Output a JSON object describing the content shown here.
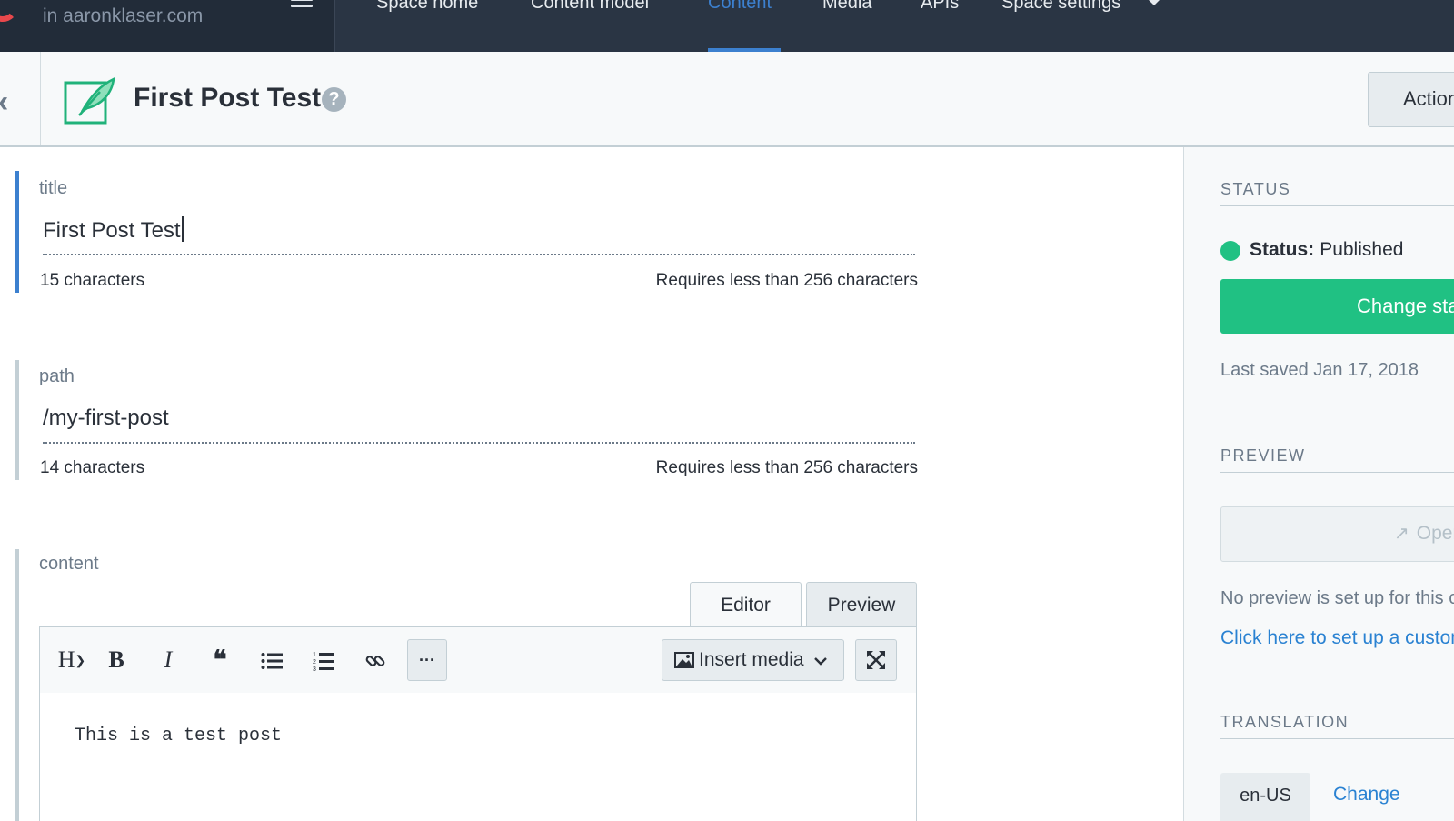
{
  "topbar": {
    "space_label": "in aaronklaser.com",
    "nav": [
      {
        "label": "Space home",
        "active": false
      },
      {
        "label": "Content model",
        "active": false
      },
      {
        "label": "Content",
        "active": true
      },
      {
        "label": "Media",
        "active": false
      },
      {
        "label": "APIs",
        "active": false
      },
      {
        "label": "Space settings",
        "active": false
      }
    ]
  },
  "header": {
    "title": "First Post Test",
    "help_glyph": "?",
    "actions_label": "Actions"
  },
  "fields": {
    "title": {
      "label": "title",
      "value": "First Post Test",
      "count": "15 characters",
      "limit": "Requires less than 256 characters"
    },
    "path": {
      "label": "path",
      "value": "/my-first-post",
      "count": "14 characters",
      "limit": "Requires less than 256 characters"
    },
    "content": {
      "label": "content",
      "tabs": {
        "editor": "Editor",
        "preview": "Preview"
      },
      "toolbar": {
        "heading": "H",
        "bold": "B",
        "italic": "I",
        "quote": "❝",
        "more": "···",
        "insert_media": "Insert media"
      },
      "body": "This is a test post"
    }
  },
  "sidebar": {
    "status_heading": "STATUS",
    "status_label": "Status:",
    "status_value": "Published",
    "change_button": "Change status",
    "last_saved": "Last saved Jan 17, 2018",
    "preview_heading": "PREVIEW",
    "open_preview": "Open preview",
    "no_preview": "No preview is set up for this content type",
    "setup_link": "Click here to set up a custom preview",
    "translation_heading": "TRANSLATION",
    "locale": "en-US",
    "locale_change": "Change"
  },
  "colors": {
    "nav_bg": "#2a3544",
    "accent_blue": "#3c80cf",
    "published_green": "#20c183",
    "link_blue": "#2a82d2"
  }
}
